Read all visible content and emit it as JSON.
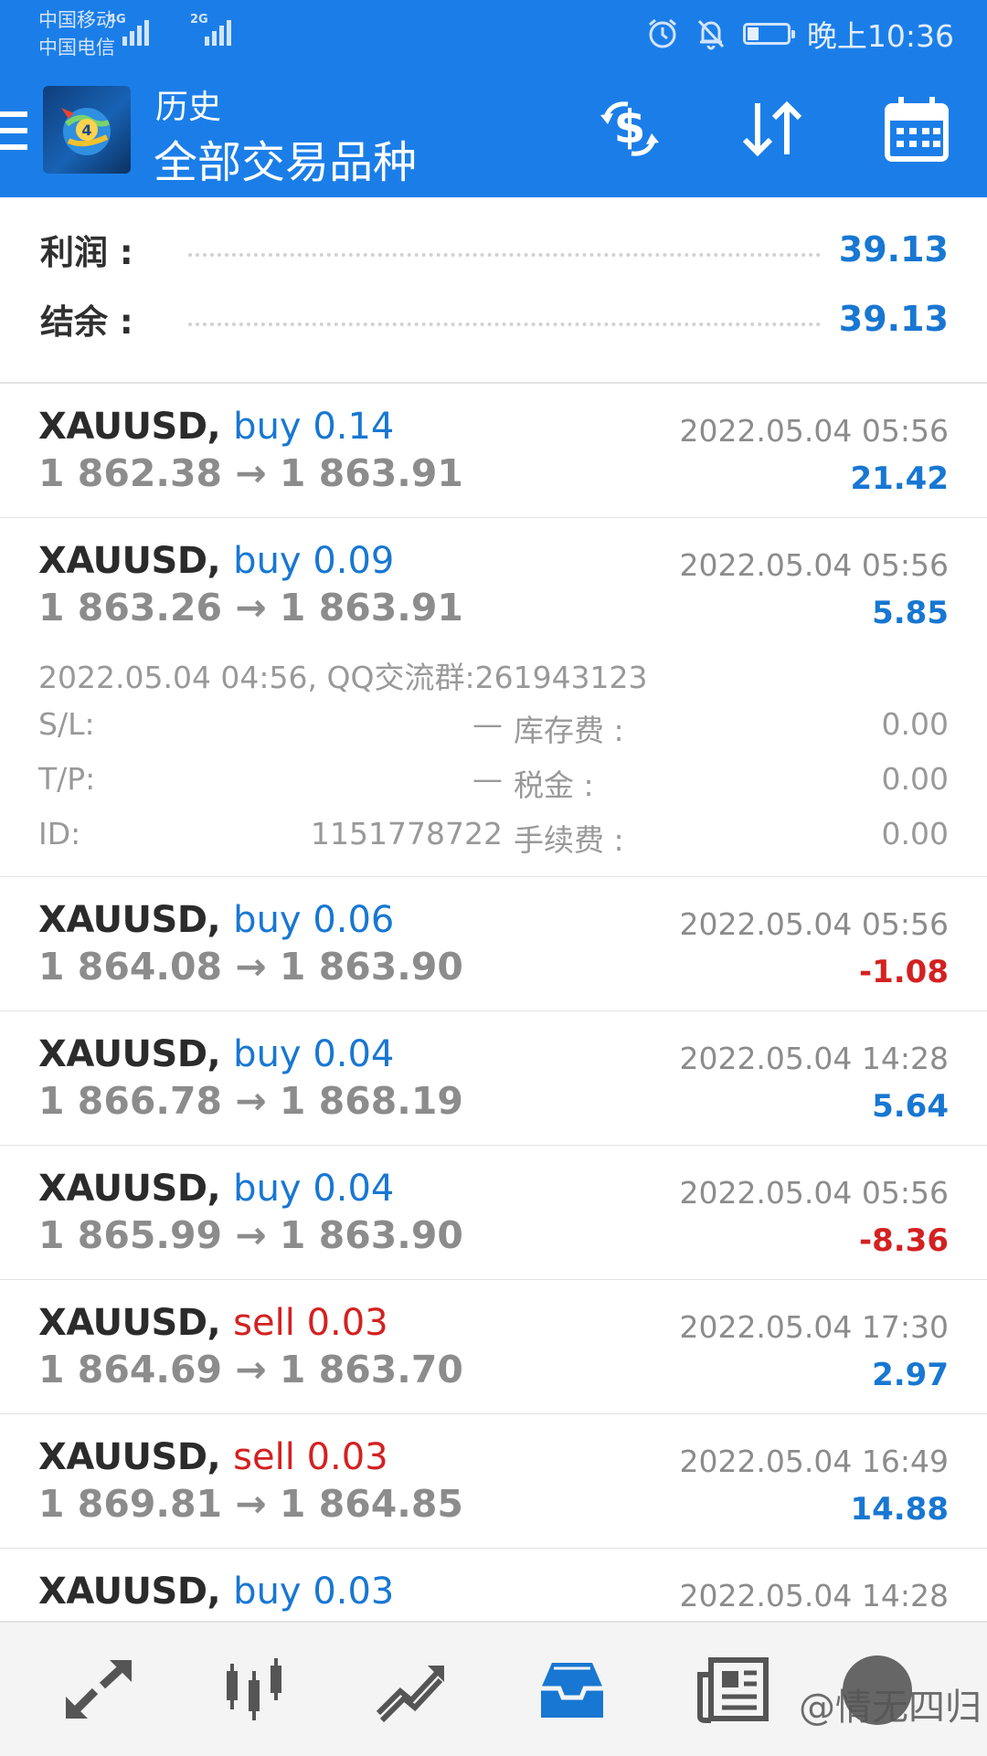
{
  "status_bar": {
    "carrier1": "中国移动",
    "carrier2": "中国电信",
    "net1": "4G",
    "net2": "2G",
    "clock": "晚上10:36",
    "battery_level": 0.3
  },
  "app_bar": {
    "title": "历史",
    "subtitle": "全部交易品种"
  },
  "summary": {
    "profit_label": "利润 :",
    "profit_value": "39.13",
    "balance_label": "结余 :",
    "balance_value": "39.13"
  },
  "trades": [
    {
      "symbol": "XAUUSD,",
      "side": "buy",
      "volume": "0.14",
      "prices": "1 862.38 → 1 863.91",
      "time": "2022.05.04 05:56",
      "profit": "21.42"
    },
    {
      "symbol": "XAUUSD,",
      "side": "buy",
      "volume": "0.09",
      "prices": "1 863.26 → 1 863.91",
      "time": "2022.05.04 05:56",
      "profit": "5.85",
      "details": {
        "open_line": "2022.05.04 04:56, QQ交流群:261943123",
        "sl_label": "S/L:",
        "sl_value": "—",
        "tp_label": "T/P:",
        "tp_value": "—",
        "id_label": "ID:",
        "id_value": "1151778722",
        "swap_label": "库存费 :",
        "swap_value": "0.00",
        "tax_label": "税金 :",
        "tax_value": "0.00",
        "fee_label": "手续费 :",
        "fee_value": "0.00"
      }
    },
    {
      "symbol": "XAUUSD,",
      "side": "buy",
      "volume": "0.06",
      "prices": "1 864.08 → 1 863.90",
      "time": "2022.05.04 05:56",
      "profit": "-1.08"
    },
    {
      "symbol": "XAUUSD,",
      "side": "buy",
      "volume": "0.04",
      "prices": "1 866.78 → 1 868.19",
      "time": "2022.05.04 14:28",
      "profit": "5.64"
    },
    {
      "symbol": "XAUUSD,",
      "side": "buy",
      "volume": "0.04",
      "prices": "1 865.99 → 1 863.90",
      "time": "2022.05.04 05:56",
      "profit": "-8.36"
    },
    {
      "symbol": "XAUUSD,",
      "side": "sell",
      "volume": "0.03",
      "prices": "1 864.69 → 1 863.70",
      "time": "2022.05.04 17:30",
      "profit": "2.97"
    },
    {
      "symbol": "XAUUSD,",
      "side": "sell",
      "volume": "0.03",
      "prices": "1 869.81 → 1 864.85",
      "time": "2022.05.04 16:49",
      "profit": "14.88"
    },
    {
      "symbol": "XAUUSD,",
      "side": "buy",
      "volume": "0.03",
      "prices": "",
      "time": "2022.05.04 14:28",
      "profit": ""
    }
  ],
  "bottom_nav": {
    "items": [
      "quotes-icon",
      "chart-icon",
      "trade-icon",
      "history-icon",
      "news-icon",
      "settings-icon"
    ],
    "active": "history-icon",
    "watermark": "@情无四归"
  },
  "colors": {
    "primary": "#1b7ee8",
    "buy": "#1877d2",
    "sell": "#d32121"
  }
}
